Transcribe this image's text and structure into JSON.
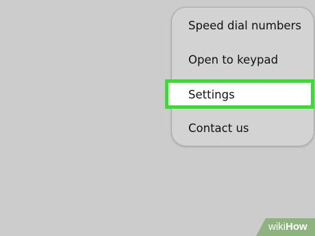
{
  "menu": {
    "items": [
      {
        "label": "Speed dial numbers"
      },
      {
        "label": "Open to keypad"
      },
      {
        "label": "Settings",
        "highlighted": true
      },
      {
        "label": "Contact us"
      }
    ]
  },
  "colors": {
    "background": "#cccccc",
    "menu_background": "#d3d3d3",
    "highlight_border": "#33e02a",
    "highlight_fill": "#ffffff",
    "watermark": "#8fb37e"
  },
  "watermark": {
    "prefix": "wiki",
    "suffix": "How"
  }
}
